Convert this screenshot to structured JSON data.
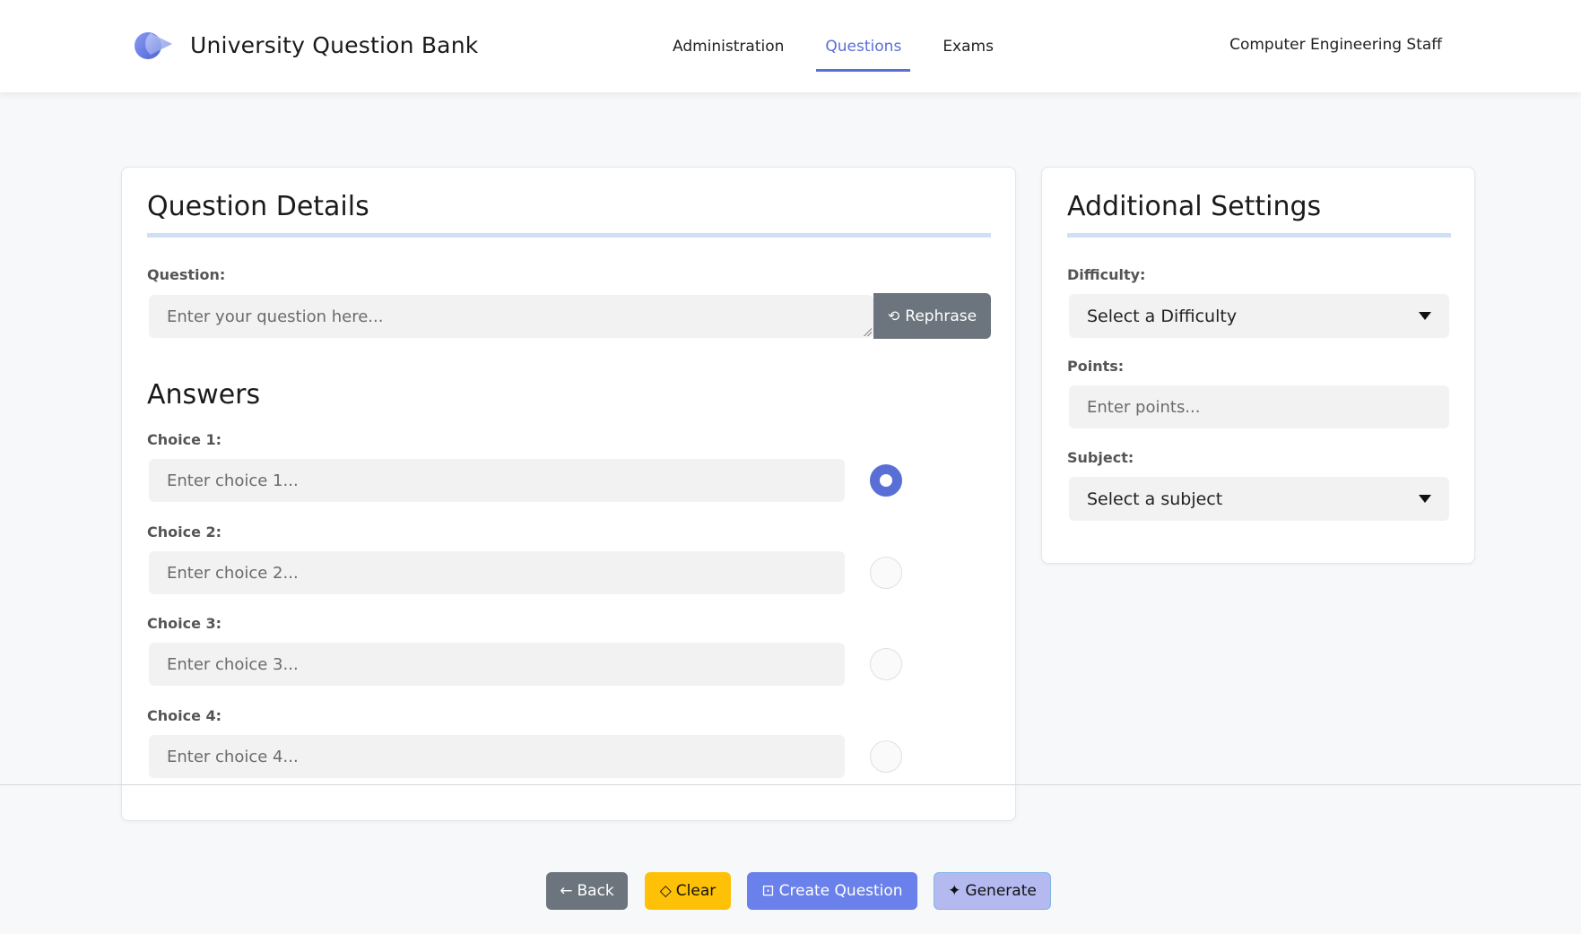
{
  "header": {
    "brand_title": "University Question Bank",
    "nav": [
      {
        "label": "Administration",
        "active": false
      },
      {
        "label": "Questions",
        "active": true
      },
      {
        "label": "Exams",
        "active": false
      }
    ],
    "user_label": "Computer Engineering Staff"
  },
  "question_details": {
    "title": "Question Details",
    "question_label": "Question:",
    "question_placeholder": "Enter your question here...",
    "rephrase_label": "Rephrase",
    "answers_title": "Answers",
    "choices": [
      {
        "label": "Choice 1:",
        "placeholder": "Enter choice 1...",
        "correct": true
      },
      {
        "label": "Choice 2:",
        "placeholder": "Enter choice 2...",
        "correct": false
      },
      {
        "label": "Choice 3:",
        "placeholder": "Enter choice 3...",
        "correct": false
      },
      {
        "label": "Choice 4:",
        "placeholder": "Enter choice 4...",
        "correct": false
      }
    ]
  },
  "additional_settings": {
    "title": "Additional Settings",
    "difficulty_label": "Difficulty:",
    "difficulty_value": "Select a Difficulty",
    "points_label": "Points:",
    "points_placeholder": "Enter points...",
    "subject_label": "Subject:",
    "subject_value": "Select a subject"
  },
  "actions": {
    "back": "Back",
    "clear": "Clear",
    "create": "Create Question",
    "generate": "Generate"
  },
  "colors": {
    "accent": "#5a6fd6",
    "back_button": "#6c757d",
    "clear_button": "#ffc107",
    "create_button": "#6a80ea",
    "generate_button": "#b4b9ef"
  }
}
